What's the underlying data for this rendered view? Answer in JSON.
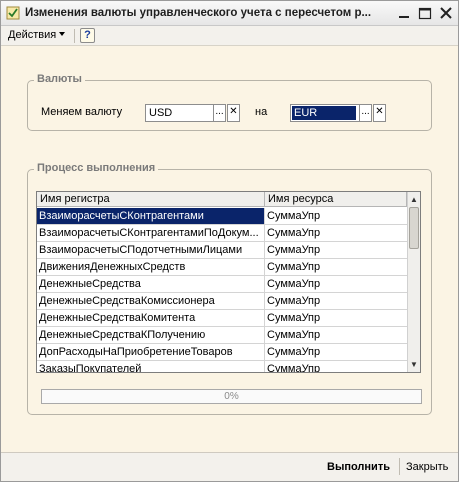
{
  "window": {
    "title": "Изменения валюты управленческого учета с пересчетом р..."
  },
  "menu": {
    "actions_label": "Действия",
    "help_label": "?"
  },
  "currencies": {
    "group_title": "Валюты",
    "change_label": "Меняем валюту",
    "from_value": "USD",
    "to_label": "на",
    "to_value": "EUR",
    "select_btn": "...",
    "clear_btn": "✕"
  },
  "process": {
    "group_title": "Процесс выполнения",
    "columns": [
      "Имя регистра",
      "Имя ресурса"
    ],
    "rows": [
      {
        "register": "ВзаиморасчетыСКонтрагентами",
        "resource": "СуммаУпр"
      },
      {
        "register": "ВзаиморасчетыСКонтрагентамиПоДокум...",
        "resource": "СуммаУпр"
      },
      {
        "register": "ВзаиморасчетыСПодотчетнымиЛицами",
        "resource": "СуммаУпр"
      },
      {
        "register": "ДвиженияДенежныхСредств",
        "resource": "СуммаУпр"
      },
      {
        "register": "ДенежныеСредства",
        "resource": "СуммаУпр"
      },
      {
        "register": "ДенежныеСредстваКомиссионера",
        "resource": "СуммаУпр"
      },
      {
        "register": "ДенежныеСредстваКомитента",
        "resource": "СуммаУпр"
      },
      {
        "register": "ДенежныеСредстваКПолучению",
        "resource": "СуммаУпр"
      },
      {
        "register": "ДопРасходыНаПриобретениеТоваров",
        "resource": "СуммаУпр"
      },
      {
        "register": "ЗаказыПокупателей",
        "resource": "СуммаУпр"
      }
    ],
    "progress_text": "0%",
    "progress_value": 0
  },
  "footer": {
    "execute_label": "Выполнить",
    "close_label": "Закрыть"
  }
}
